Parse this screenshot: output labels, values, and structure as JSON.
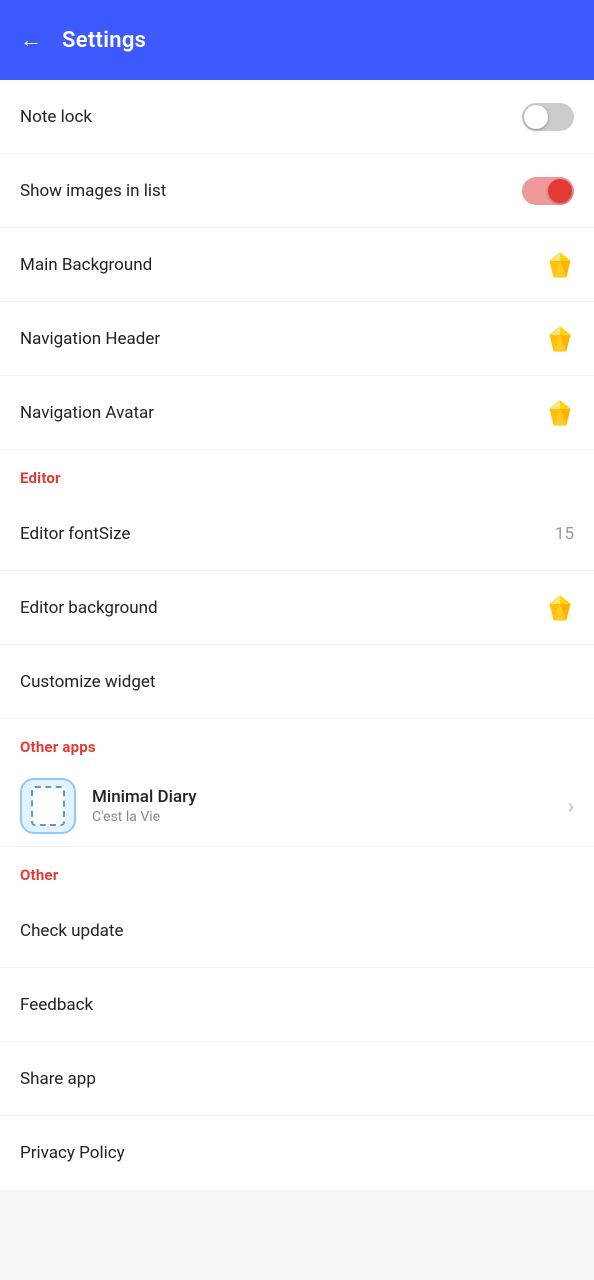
{
  "header": {
    "title": "Settings",
    "back_label": "←"
  },
  "settings": {
    "items": [
      {
        "id": "note-lock",
        "label": "Note lock",
        "type": "toggle",
        "value": false
      },
      {
        "id": "show-images",
        "label": "Show images in list",
        "type": "toggle",
        "value": true
      }
    ],
    "appearance": [
      {
        "id": "main-background",
        "label": "Main Background",
        "type": "premium"
      },
      {
        "id": "navigation-header",
        "label": "Navigation Header",
        "type": "premium"
      },
      {
        "id": "navigation-avatar",
        "label": "Navigation Avatar",
        "type": "premium"
      }
    ],
    "editor_section_label": "Editor",
    "editor": [
      {
        "id": "editor-fontsize",
        "label": "Editor fontSize",
        "type": "value",
        "value": "15"
      },
      {
        "id": "editor-background",
        "label": "Editor background",
        "type": "premium"
      },
      {
        "id": "customize-widget",
        "label": "Customize widget",
        "type": "none"
      }
    ],
    "other_apps_section_label": "Other apps",
    "apps": [
      {
        "id": "minimal-diary",
        "name": "Minimal Diary",
        "subtitle": "C'est la Vie"
      }
    ],
    "other_section_label": "Other",
    "other": [
      {
        "id": "check-update",
        "label": "Check update"
      },
      {
        "id": "feedback",
        "label": "Feedback"
      },
      {
        "id": "share-app",
        "label": "Share app"
      },
      {
        "id": "privacy-policy",
        "label": "Privacy Policy"
      }
    ]
  }
}
